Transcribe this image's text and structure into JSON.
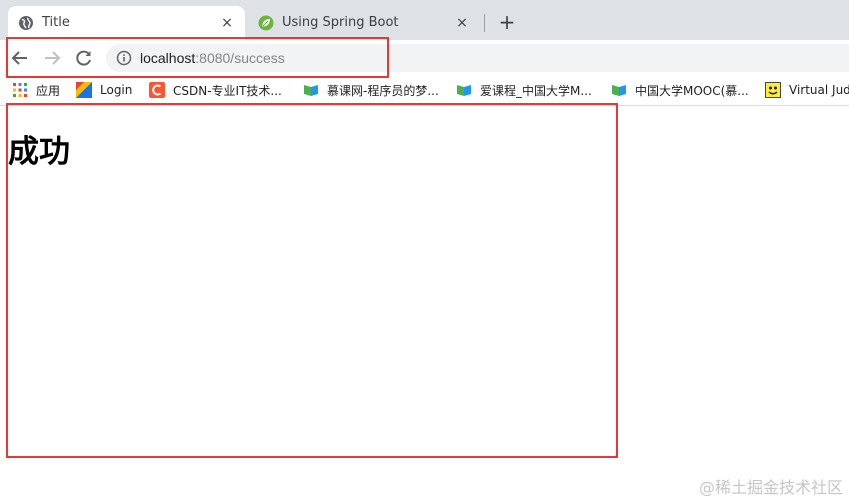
{
  "tabs": [
    {
      "title": "Title",
      "close": "×",
      "icon": "globe-icon"
    },
    {
      "title": "Using Spring Boot",
      "close": "×",
      "icon": "spring-leaf-icon"
    }
  ],
  "new_tab": "+",
  "toolbar": {
    "url_host": "localhost",
    "url_rest": ":8080/success"
  },
  "bookmarks": [
    {
      "label": "应用",
      "icon": "apps-grid-icon"
    },
    {
      "label": "Login",
      "icon": "login-icon"
    },
    {
      "label": "CSDN-专业IT技术...",
      "icon": "csdn-icon"
    },
    {
      "label": "慕课网-程序员的梦...",
      "icon": "imooc-icon"
    },
    {
      "label": "爱课程_中国大学M...",
      "icon": "icourse-icon"
    },
    {
      "label": "中国大学MOOC(慕...",
      "icon": "icourse-icon"
    },
    {
      "label": "Virtual Jud",
      "icon": "vjudge-icon"
    }
  ],
  "content": {
    "heading": "成功"
  },
  "watermark": "@稀土掘金技术社区",
  "colors": {
    "annotation": "#e53935",
    "tab_strip": "#dee1e6"
  }
}
